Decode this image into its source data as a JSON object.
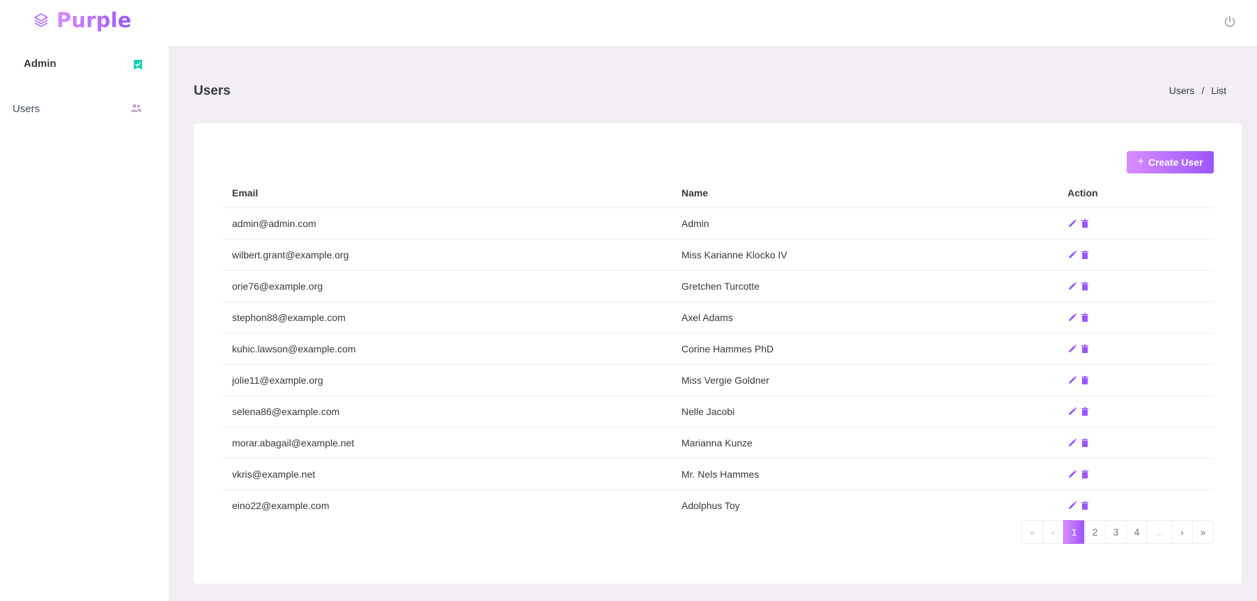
{
  "brand": {
    "name": "Purple"
  },
  "sidebar": {
    "profile_name": "Admin",
    "items": [
      {
        "label": "Users",
        "icon": "users-icon"
      }
    ]
  },
  "header": {
    "title": "Users",
    "breadcrumb": [
      "Users",
      "List"
    ]
  },
  "toolbar": {
    "create_label": "Create User"
  },
  "table": {
    "columns": [
      "Email",
      "Name",
      "Action"
    ],
    "rows": [
      {
        "email": "admin@admin.com",
        "name": "Admin"
      },
      {
        "email": "wilbert.grant@example.org",
        "name": "Miss Karianne Klocko IV"
      },
      {
        "email": "orie76@example.org",
        "name": "Gretchen Turcotte"
      },
      {
        "email": "stephon88@example.com",
        "name": "Axel Adams"
      },
      {
        "email": "kuhic.lawson@example.com",
        "name": "Corine Hammes PhD"
      },
      {
        "email": "jolie11@example.org",
        "name": "Miss Vergie Goldner"
      },
      {
        "email": "selena86@example.com",
        "name": "Nelle Jacobi"
      },
      {
        "email": "morar.abagail@example.net",
        "name": "Marianna Kunze"
      },
      {
        "email": "vkris@example.net",
        "name": "Mr. Nels Hammes"
      },
      {
        "email": "eino22@example.com",
        "name": "Adolphus Toy"
      }
    ]
  },
  "pagination": {
    "first": "«",
    "prev": "‹",
    "pages": [
      "1",
      "2",
      "3",
      "4"
    ],
    "active": "1",
    "ellipsis": "…",
    "next": "›",
    "last": "»"
  },
  "colors": {
    "accent_start": "#da8cff",
    "accent_end": "#9a55ff",
    "action_icon": "#9a55ff",
    "verified_badge": "#1bcfb4",
    "background": "#f2edf3"
  }
}
